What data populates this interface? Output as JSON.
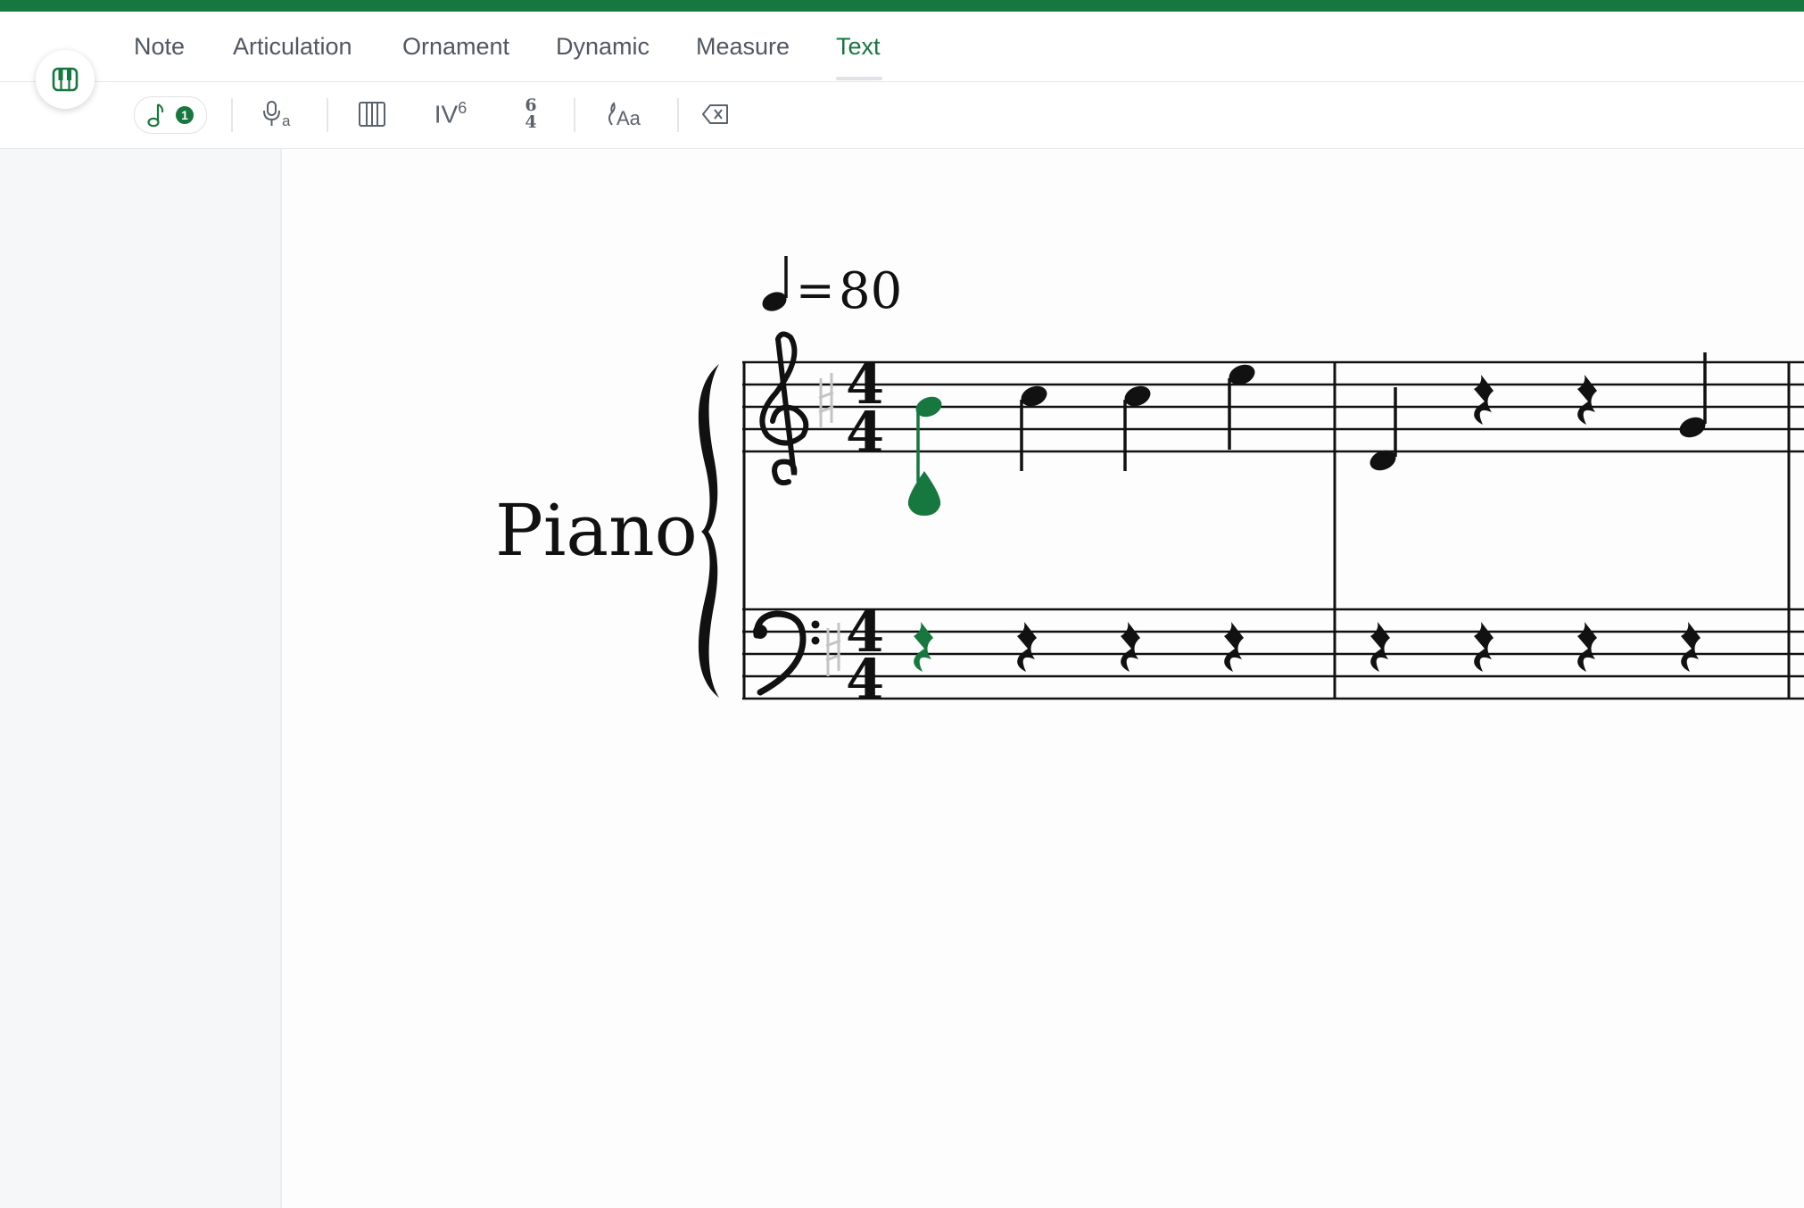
{
  "tabs": [
    {
      "label": "Note",
      "active": false
    },
    {
      "label": "Articulation",
      "active": false
    },
    {
      "label": "Ornament",
      "active": false
    },
    {
      "label": "Dynamic",
      "active": false
    },
    {
      "label": "Measure",
      "active": false
    },
    {
      "label": "Text",
      "active": true
    }
  ],
  "toolbar": {
    "voice_badge": "1",
    "roman_numeral": "IV",
    "roman_superscript": "6",
    "figured_top": "6",
    "figured_bottom": "4",
    "icons": [
      "piano-icon",
      "voice-note-icon",
      "lyrics-icon",
      "measure-bars-icon",
      "roman-numeral-icon",
      "figured-bass-icon",
      "text-style-icon",
      "delete-icon"
    ]
  },
  "score": {
    "instrument": "Piano",
    "tempo_equals": "=",
    "tempo_value": "80",
    "time_signature": {
      "numerator": "4",
      "denominator": "4"
    },
    "accent_color": "#17783f"
  }
}
